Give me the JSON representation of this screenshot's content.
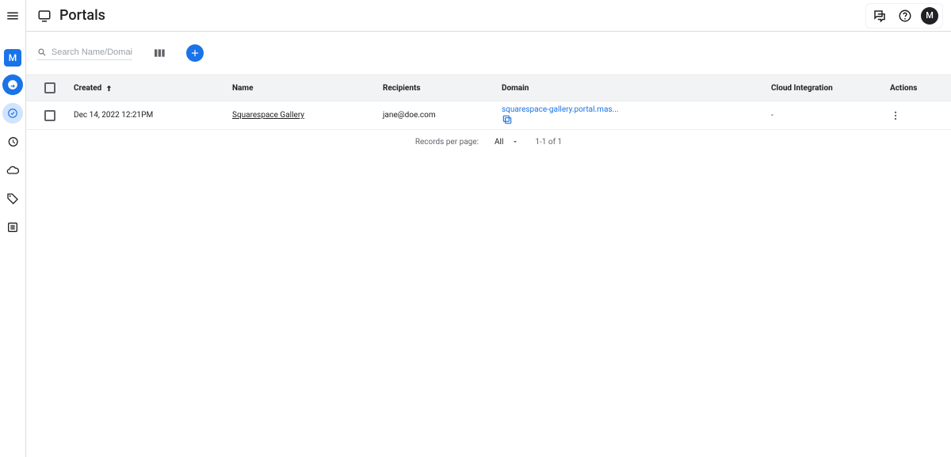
{
  "header": {
    "title": "Portals",
    "avatar_letter": "M"
  },
  "sidebar": {
    "avatar_letter": "M"
  },
  "search": {
    "placeholder": "Search Name/Domain"
  },
  "table": {
    "headers": {
      "created": "Created",
      "name": "Name",
      "recipients": "Recipients",
      "domain": "Domain",
      "cloud_integration": "Cloud Integration",
      "actions": "Actions"
    },
    "rows": [
      {
        "created": "Dec 14, 2022 12:21PM",
        "name": "Squarespace Gallery",
        "recipients": "jane@doe.com",
        "domain": "squarespace-gallery.portal.mas...",
        "cloud_integration": "-"
      }
    ]
  },
  "pagination": {
    "records_label": "Records per page:",
    "page_size": "All",
    "range": "1-1 of 1"
  }
}
